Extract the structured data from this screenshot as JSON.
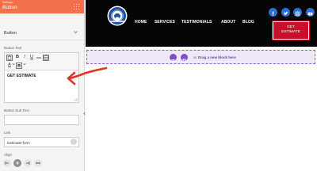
{
  "panel": {
    "subtitle": "Settings",
    "title": "Button",
    "section_label": "Button",
    "button_text_label": "Button Text",
    "editor_content": "GET ESTIMATE",
    "button_subtext_label": "Button Sub Text",
    "button_subtext_value": "",
    "link_label": "Link",
    "link_value": "/estimate-form",
    "align_label": "Align",
    "toolbar": {
      "bold": "B",
      "italic": "I",
      "underline": "U",
      "font_color": "A"
    }
  },
  "site": {
    "nav": [
      "HOME",
      "SERVICES",
      "TESTIMONIALS",
      "ABOUT",
      "BLOG"
    ],
    "cta_line1": "GET",
    "cta_line2": "ESTIMATE",
    "social_icons": [
      "facebook-icon",
      "twitter-icon",
      "instagram-icon",
      "youtube-icon"
    ]
  },
  "dropzone": {
    "or_text": "or",
    "drag_text": "Drag a new block here"
  },
  "colors": {
    "panel_header": "#f0714a",
    "cta": "#c8102e",
    "dropzone_accent": "#7e4fc0",
    "annotation_arrow": "#e0352b"
  }
}
